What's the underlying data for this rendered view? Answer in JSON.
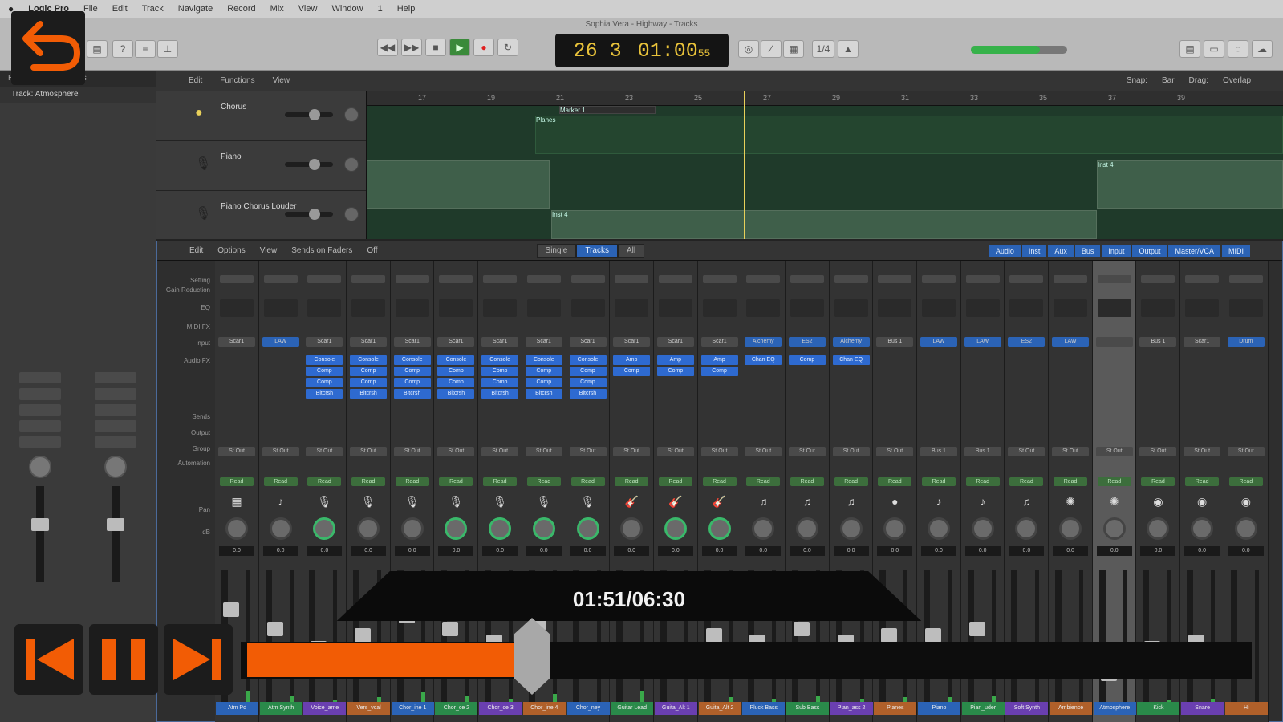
{
  "menubar": {
    "app": "Logic Pro",
    "items": [
      "File",
      "Edit",
      "Track",
      "Navigate",
      "Record",
      "Mix",
      "View",
      "Window",
      "1",
      "Help"
    ]
  },
  "window_title": "Sophia Vera - Highway - Tracks",
  "lcd": {
    "position": "26 3",
    "time": "01:00",
    "time_small": "55"
  },
  "inspector": {
    "header": "Region: MIDI Defaults",
    "track_label": "Track: Atmosphere"
  },
  "tracks_bar": {
    "items": [
      "Edit",
      "Functions",
      "View"
    ],
    "snap_label": "Snap:",
    "snap_value": "Bar",
    "drag_label": "Drag:",
    "drag_value": "Overlap"
  },
  "tracks": [
    {
      "name": "Chorus"
    },
    {
      "name": "Piano"
    },
    {
      "name": "Piano Chorus Louder"
    }
  ],
  "ruler": [
    "17",
    "19",
    "21",
    "23",
    "25",
    "27",
    "29",
    "31",
    "33",
    "35",
    "37",
    "39"
  ],
  "marker": "Marker 1",
  "regions": {
    "planes": "Planes",
    "inst": "Inst 4"
  },
  "mixer_bar": {
    "items": [
      "Edit",
      "Options",
      "View",
      "Sends on Faders",
      "Off"
    ],
    "modes": [
      "Single",
      "Tracks",
      "All"
    ],
    "filters": [
      "Audio",
      "Inst",
      "Aux",
      "Bus",
      "Input",
      "Output",
      "Master/VCA",
      "MIDI"
    ]
  },
  "row_labels": {
    "setting": "Setting",
    "gain": "Gain Reduction",
    "eq": "EQ",
    "midi": "MIDI FX",
    "input": "Input",
    "audio_fx": "Audio FX",
    "sends": "Sends",
    "output": "Output",
    "group": "Group",
    "automation": "Automation",
    "pan": "Pan",
    "db": "dB"
  },
  "channels": [
    {
      "input": "Scar1",
      "plugins": [],
      "out": "St Out",
      "auto": "Read",
      "pan_green": false,
      "db": "0.0",
      "name": "Atm Pd",
      "icon": "▦"
    },
    {
      "input": "LAW",
      "input_blue": true,
      "plugins": [],
      "out": "St Out",
      "auto": "Read",
      "pan_green": false,
      "db": "0.0",
      "name": "Atm Synth",
      "icon": "♪"
    },
    {
      "input": "Scar1",
      "plugins": [
        "Console",
        "Comp",
        "Comp",
        "Bitcrsh"
      ],
      "out": "St Out",
      "auto": "Read",
      "pan_green": true,
      "db": "0.0",
      "name": "Voice_ame",
      "icon": "🎙"
    },
    {
      "input": "Scar1",
      "plugins": [
        "Console",
        "Comp",
        "Comp",
        "Bitcrsh"
      ],
      "out": "St Out",
      "auto": "Read",
      "pan_green": false,
      "db": "0.0",
      "name": "Vers_vcal",
      "icon": "🎙"
    },
    {
      "input": "Scar1",
      "plugins": [
        "Console",
        "Comp",
        "Comp",
        "Bitcrsh"
      ],
      "out": "St Out",
      "auto": "Read",
      "pan_green": false,
      "db": "0.0",
      "name": "Chor_ine 1",
      "icon": "🎙"
    },
    {
      "input": "Scar1",
      "plugins": [
        "Console",
        "Comp",
        "Comp",
        "Bitcrsh"
      ],
      "out": "St Out",
      "auto": "Read",
      "pan_green": true,
      "db": "0.0",
      "name": "Chor_ce 2",
      "icon": "🎙"
    },
    {
      "input": "Scar1",
      "plugins": [
        "Console",
        "Comp",
        "Comp",
        "Bitcrsh"
      ],
      "out": "St Out",
      "auto": "Read",
      "pan_green": true,
      "db": "0.0",
      "name": "Chor_ce 3",
      "icon": "🎙"
    },
    {
      "input": "Scar1",
      "plugins": [
        "Console",
        "Comp",
        "Comp",
        "Bitcrsh"
      ],
      "out": "St Out",
      "auto": "Read",
      "pan_green": true,
      "db": "0.0",
      "name": "Chor_ine 4",
      "icon": "🎙"
    },
    {
      "input": "Scar1",
      "plugins": [
        "Console",
        "Comp",
        "Comp",
        "Bitcrsh"
      ],
      "out": "St Out",
      "auto": "Read",
      "pan_green": true,
      "db": "0.0",
      "name": "Chor_ney",
      "icon": "🎙"
    },
    {
      "input": "Scar1",
      "plugins": [
        "Amp",
        "Comp"
      ],
      "out": "St Out",
      "auto": "Read",
      "pan_green": false,
      "db": "0.0",
      "name": "Guitar Lead",
      "icon": "🎸"
    },
    {
      "input": "Scar1",
      "plugins": [
        "Amp",
        "Comp"
      ],
      "out": "St Out",
      "auto": "Read",
      "pan_green": true,
      "db": "0.0",
      "name": "Guita_Alt 1",
      "icon": "🎸"
    },
    {
      "input": "Scar1",
      "plugins": [
        "Amp",
        "Comp"
      ],
      "out": "St Out",
      "auto": "Read",
      "pan_green": true,
      "db": "0.0",
      "name": "Guita_Alt 2",
      "icon": "🎸"
    },
    {
      "input": "Alchemy",
      "input_blue": true,
      "plugins": [
        "Chan EQ"
      ],
      "out": "St Out",
      "auto": "Read",
      "pan_green": false,
      "db": "0.0",
      "name": "Pluck Bass",
      "icon": "♫"
    },
    {
      "input": "ES2",
      "input_blue": true,
      "plugins": [
        "Comp"
      ],
      "out": "St Out",
      "auto": "Read",
      "pan_green": false,
      "db": "0.0",
      "name": "Sub Bass",
      "icon": "♫"
    },
    {
      "input": "Alchemy",
      "input_blue": true,
      "plugins": [
        "Chan EQ"
      ],
      "out": "St Out",
      "auto": "Read",
      "pan_green": false,
      "db": "0.0",
      "name": "Plan_ass 2",
      "icon": "♫"
    },
    {
      "input": "Bus 1",
      "plugins": [],
      "out": "St Out",
      "auto": "Read",
      "pan_green": false,
      "db": "0.0",
      "name": "Planes",
      "icon": "●"
    },
    {
      "input": "LAW",
      "input_blue": true,
      "plugins": [],
      "out": "Bus 1",
      "auto": "Read",
      "pan_green": false,
      "db": "0.0",
      "name": "Piano",
      "icon": "♪"
    },
    {
      "input": "LAW",
      "input_blue": true,
      "plugins": [],
      "out": "Bus 1",
      "auto": "Read",
      "pan_green": false,
      "db": "0.0",
      "name": "Pian_uder",
      "icon": "♪"
    },
    {
      "input": "ES2",
      "input_blue": true,
      "plugins": [],
      "out": "St Out",
      "auto": "Read",
      "pan_green": false,
      "db": "0.0",
      "name": "Soft Synth",
      "icon": "♫"
    },
    {
      "input": "LAW",
      "input_blue": true,
      "plugins": [],
      "out": "St Out",
      "auto": "Read",
      "pan_green": false,
      "db": "0.0",
      "name": "Ambience",
      "icon": "✺"
    },
    {
      "input": "",
      "plugins": [],
      "out": "St Out",
      "auto": "Read",
      "pan_green": false,
      "db": "0.0",
      "name": "Atmosphere",
      "icon": "✺",
      "selected": true
    },
    {
      "input": "Bus 1",
      "plugins": [],
      "out": "St Out",
      "auto": "Read",
      "pan_green": false,
      "db": "0.0",
      "name": "Kick",
      "icon": "◉"
    },
    {
      "input": "Scar1",
      "plugins": [],
      "out": "St Out",
      "auto": "Read",
      "pan_green": false,
      "db": "0.0",
      "name": "Snare",
      "icon": "◉"
    },
    {
      "input": "Drum",
      "input_blue": true,
      "plugins": [],
      "out": "St Out",
      "auto": "Read",
      "pan_green": false,
      "db": "0.0",
      "name": "Hi",
      "icon": "◉"
    }
  ],
  "fader_levels": [
    0.75,
    0.6,
    0.45,
    0.55,
    0.7,
    0.6,
    0.5,
    0.65,
    0.4,
    0.75,
    0.4,
    0.55,
    0.5,
    0.6,
    0.5,
    0.55,
    0.55,
    0.6,
    0.3,
    0.35,
    0.25,
    0.45,
    0.5,
    0.35
  ],
  "video": {
    "time": "01:51/06:30",
    "progress": 0.285
  },
  "colors": {
    "accent_orange": "#f25c05",
    "lcd_amber": "#e8c23a",
    "plugin_blue": "#2e6ad0",
    "play_green": "#3a8a3a"
  }
}
